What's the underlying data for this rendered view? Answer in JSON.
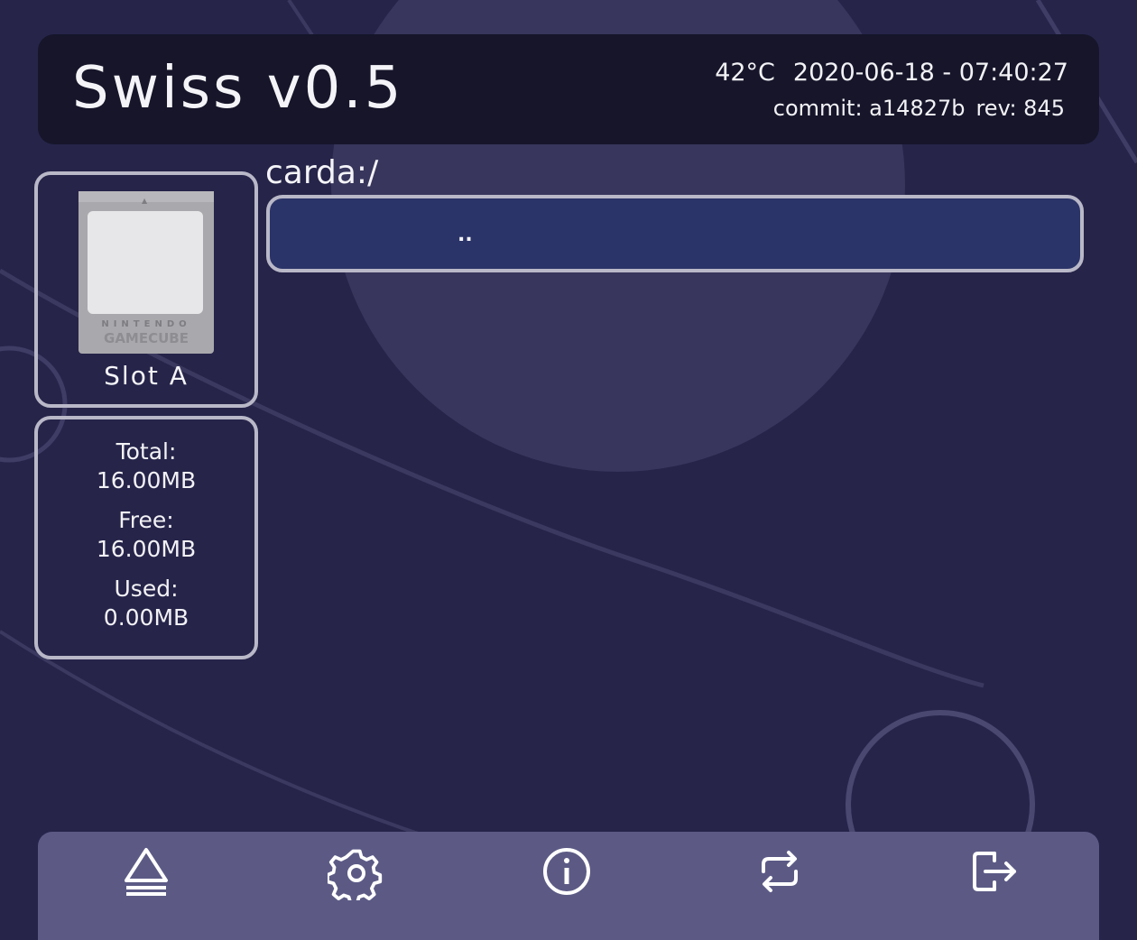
{
  "header": {
    "title": "Swiss v0.5",
    "temperature": "42°C",
    "datetime": "2020-06-18 - 07:40:27",
    "commit": "commit: a14827b",
    "revision": "rev: 845"
  },
  "device": {
    "card_brand_top": "NINTENDO",
    "card_brand_bottom": "GAMECUBE",
    "slot_label": "Slot A"
  },
  "storage": {
    "total_label": "Total:",
    "total_value": "16.00MB",
    "free_label": "Free:",
    "free_value": "16.00MB",
    "used_label": "Used:",
    "used_value": "0.00MB"
  },
  "browser": {
    "path": "carda:/",
    "entries": [
      ".."
    ]
  },
  "toolbar": {
    "buttons": [
      "eject-icon",
      "gear-icon",
      "info-icon",
      "swap-icon",
      "exit-icon"
    ]
  },
  "colors": {
    "background": "#262449",
    "header": "#16152a",
    "selected_row": "#2b3468",
    "toolbar": "#5c5a85",
    "border": "#b9b8c8"
  }
}
